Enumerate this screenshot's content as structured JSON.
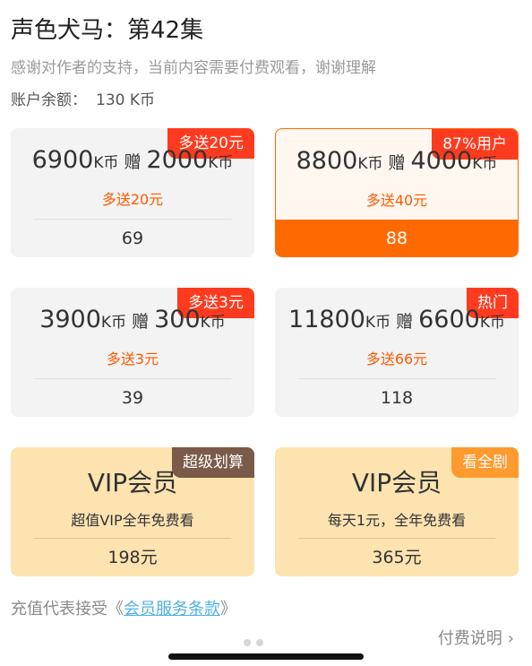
{
  "header": {
    "title": "声色犬马：第42集",
    "subtitle": "感谢对作者的支持，当前内容需要付费观看，谢谢理解",
    "balance_label": "账户余额：",
    "balance_value": "130 K币"
  },
  "packages": [
    {
      "badge": "多送20元",
      "coins": "6900",
      "unit": "K币",
      "gift_word": "赠",
      "gift": "2000",
      "gift_unit": "K币",
      "bonus": "多送20元",
      "price": "69",
      "selected": false
    },
    {
      "badge": "87%用户",
      "coins": "8800",
      "unit": "K币",
      "gift_word": "赠",
      "gift": "4000",
      "gift_unit": "K币",
      "bonus": "多送40元",
      "price": "88",
      "selected": true
    },
    {
      "badge": "多送3元",
      "coins": "3900",
      "unit": "K币",
      "gift_word": "赠",
      "gift": "300",
      "gift_unit": "K币",
      "bonus": "多送3元",
      "price": "39",
      "selected": false
    },
    {
      "badge": "热门",
      "coins": "11800",
      "unit": "K币",
      "gift_word": "赠",
      "gift": "6600",
      "gift_unit": "K币",
      "bonus": "多送66元",
      "price": "118",
      "selected": false
    }
  ],
  "vip": [
    {
      "badge": "超级划算",
      "title": "VIP会员",
      "desc": "超值VIP全年免费看",
      "price": "198元"
    },
    {
      "badge": "看全剧",
      "title": "VIP会员",
      "desc": "每天1元，全年免费看",
      "price": "365元"
    }
  ],
  "footer": {
    "terms_prefix": "充值代表接受《",
    "terms_link": "会员服务条款",
    "terms_suffix": "》",
    "help_label": "付费说明",
    "chevron_icon": "chevron-right-icon"
  },
  "colors": {
    "accent": "#ff6a00",
    "badge_red": "#ff3b1f",
    "vip_bg": "#fde3b0",
    "link": "#4fb0e6"
  }
}
